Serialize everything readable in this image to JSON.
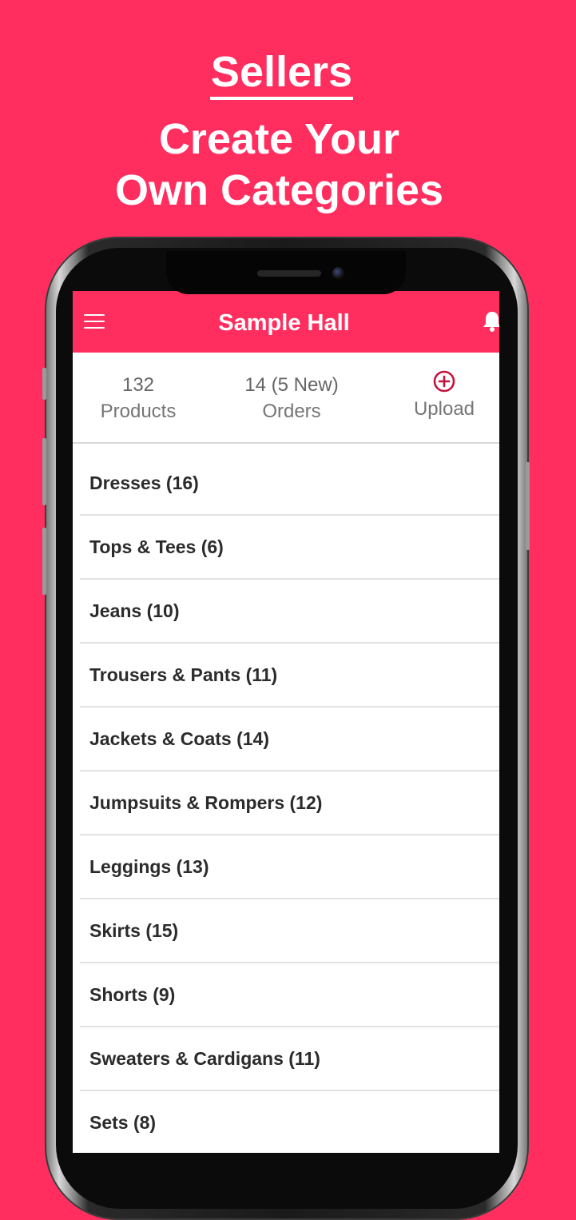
{
  "promo": {
    "kicker": "Sellers",
    "headline_line1": "Create Your",
    "headline_line2": "Own Categories"
  },
  "app": {
    "title": "Sample Hall",
    "menu_icon": "hamburger-menu-icon",
    "bell_icon": "bell-icon",
    "accent_color": "#FF2E5F",
    "upload_icon_color": "#C2123C"
  },
  "stats": {
    "products_count": "132",
    "products_label": "Products",
    "orders_count": "14 (5 New)",
    "orders_label": "Orders",
    "upload_label": "Upload",
    "upload_icon": "plus-circle-icon"
  },
  "categories": [
    "Dresses (16)",
    "Tops & Tees (6)",
    "Jeans (10)",
    "Trousers & Pants (11)",
    "Jackets & Coats (14)",
    "Jumpsuits & Rompers (12)",
    "Leggings (13)",
    "Skirts (15)",
    "Shorts (9)",
    "Sweaters & Cardigans (11)",
    "Sets (8)"
  ]
}
